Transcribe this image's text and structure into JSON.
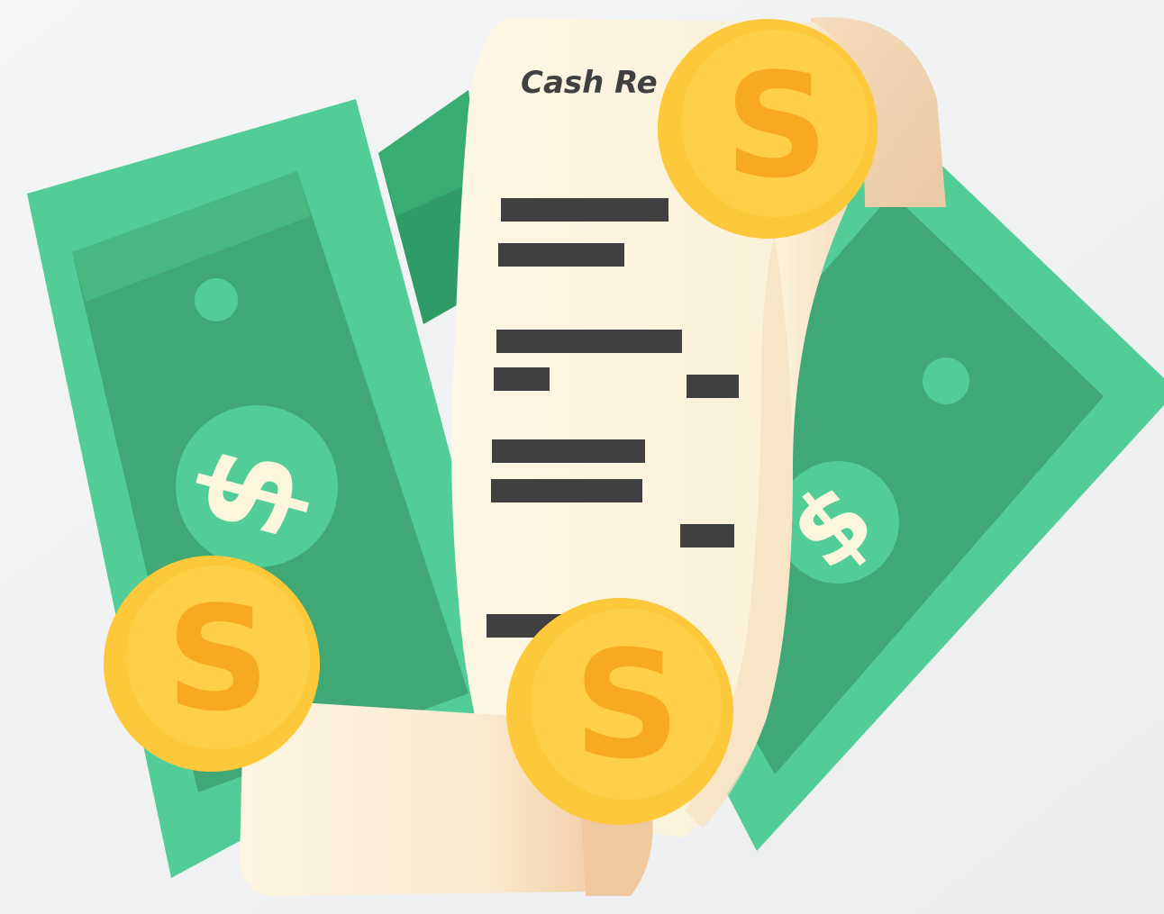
{
  "illustration": {
    "receipt_title": "Cash Re",
    "colors": {
      "background": "#f2f3f4",
      "bill_light": "#52cd97",
      "bill_mid": "#3fa873",
      "bill_dark": "#2e9462",
      "bill_symbol": "#fbf6dc",
      "coin_outer": "#fdc93a",
      "coin_inner": "#ffd047",
      "coin_symbol": "#f7a91f",
      "receipt_paper": "#fdf5e0",
      "receipt_shadow": "#f0d9b5",
      "receipt_text": "#404040"
    },
    "icons": [
      "dollar-bill-icon",
      "coin-icon",
      "receipt-icon",
      "dollar-sign-icon"
    ]
  }
}
